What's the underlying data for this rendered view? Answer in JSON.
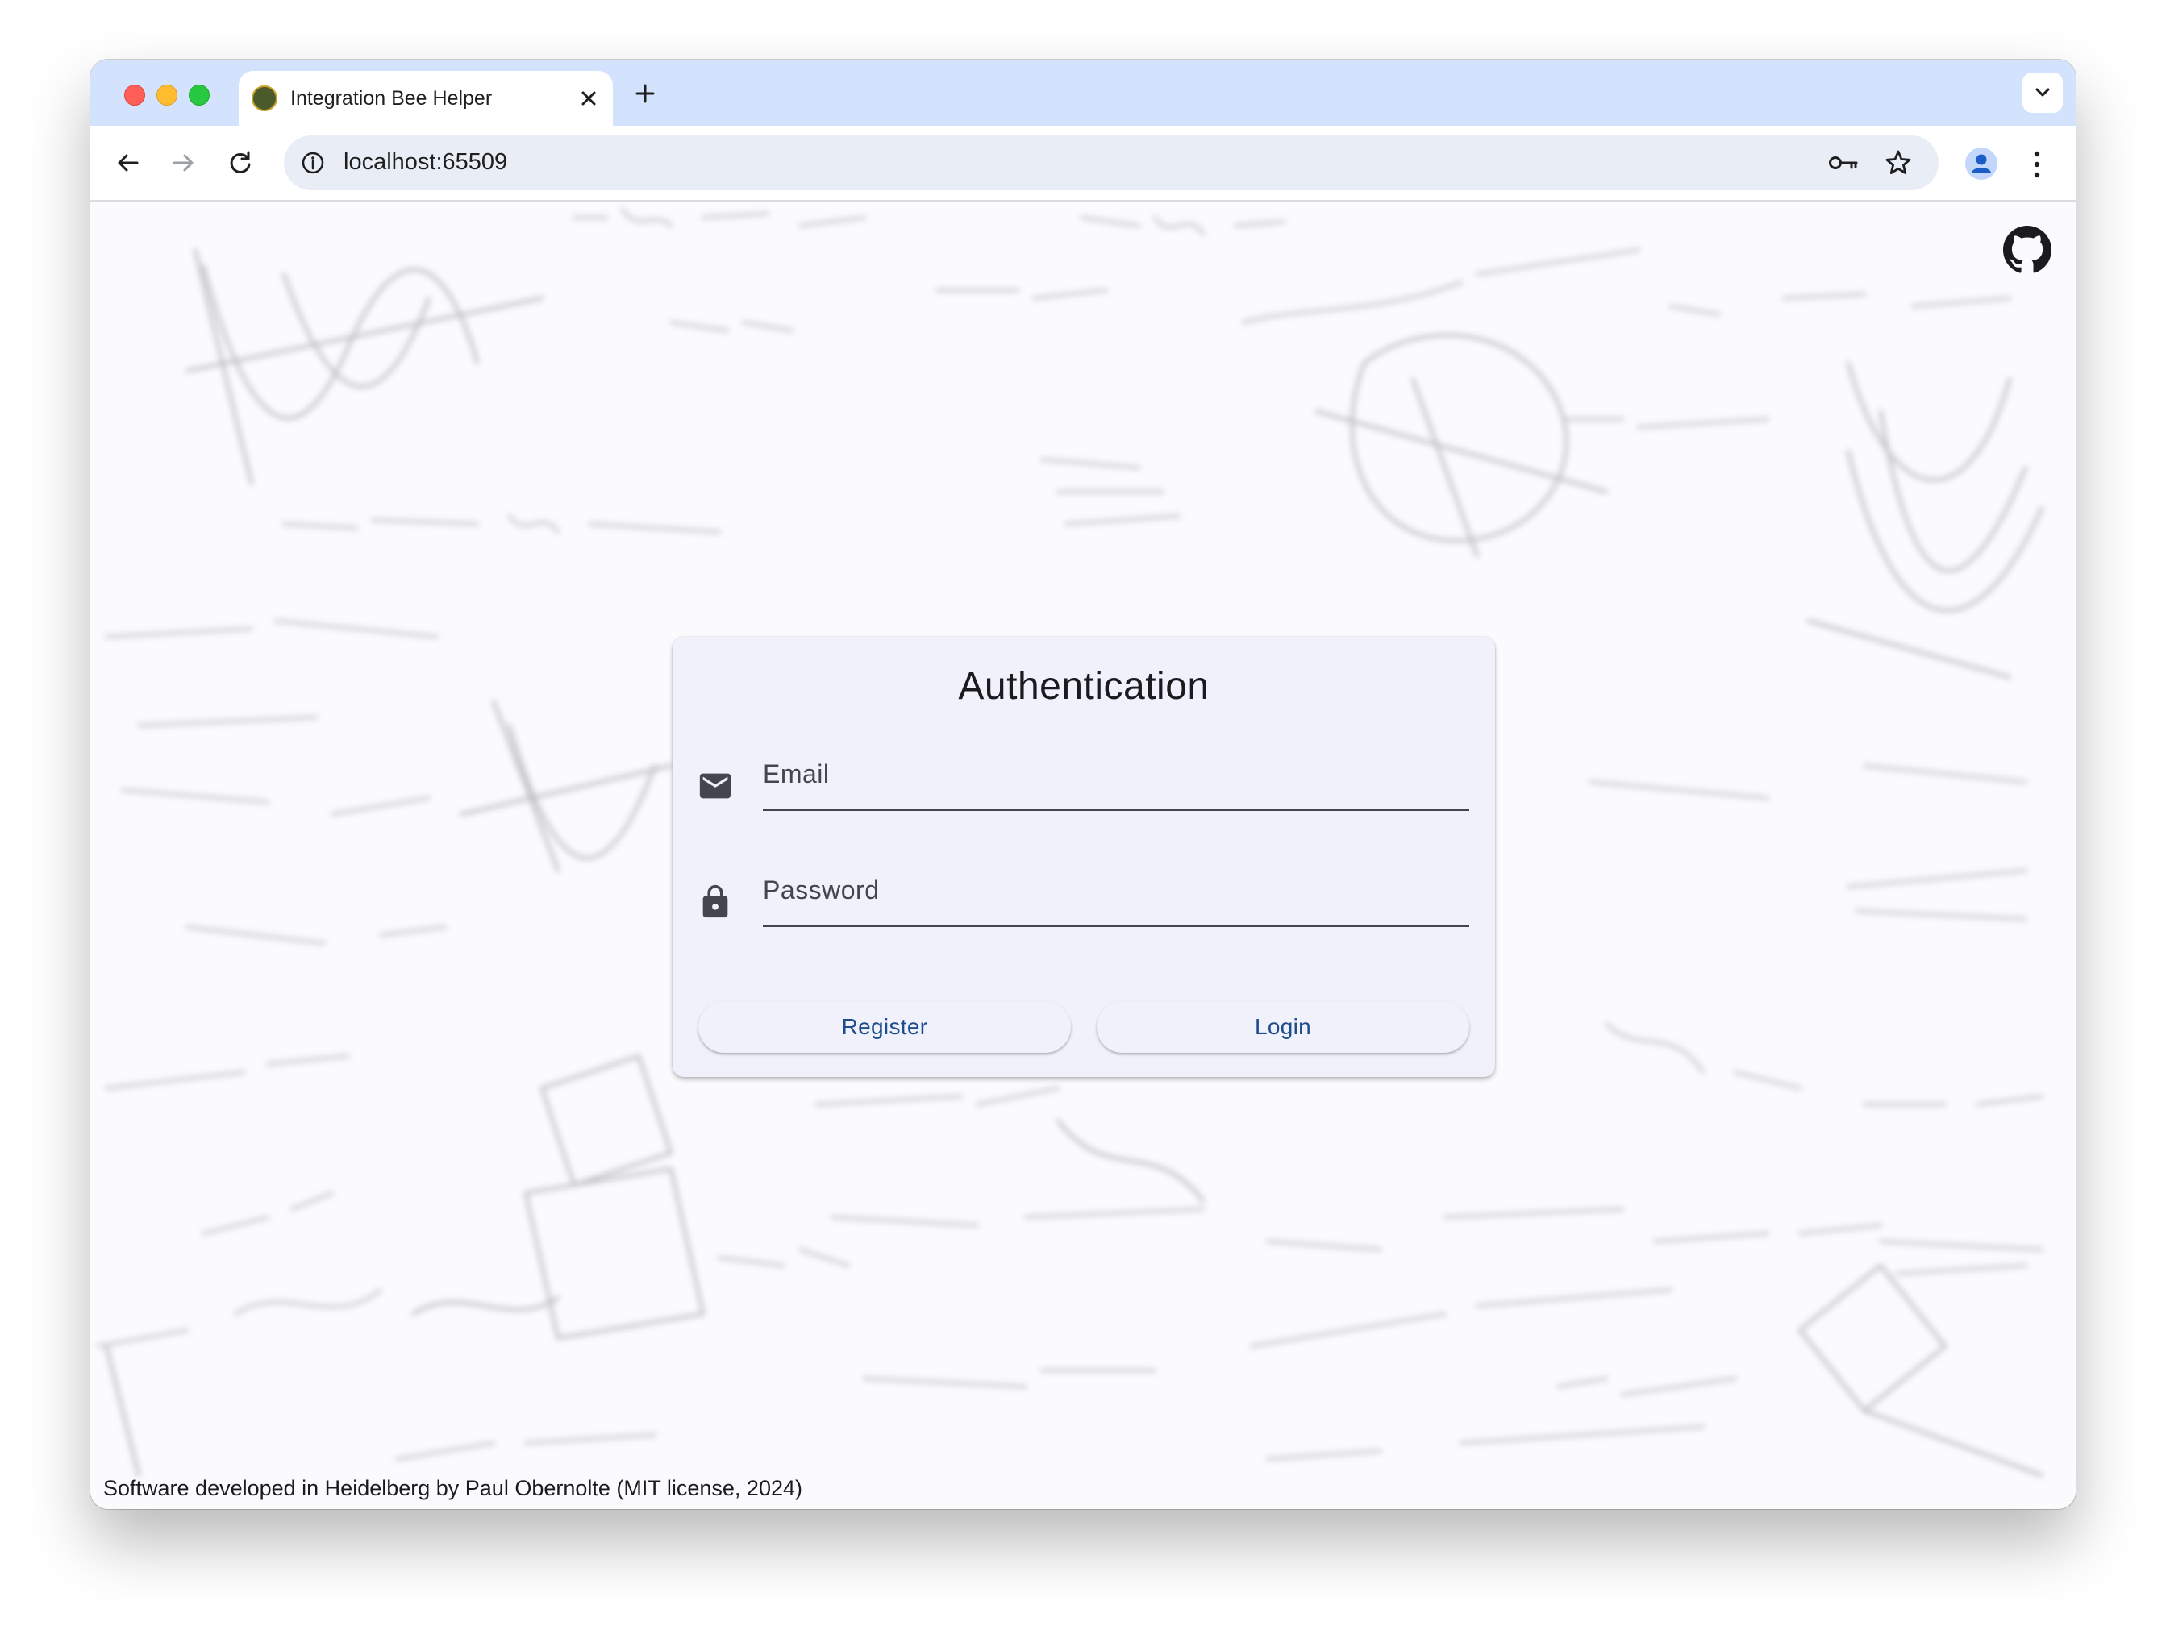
{
  "browser": {
    "tab_title": "Integration Bee Helper",
    "url": "localhost:65509"
  },
  "auth": {
    "title": "Authentication",
    "email_label": "Email",
    "password_label": "Password",
    "register_label": "Register",
    "login_label": "Login"
  },
  "footer": {
    "text": "Software developed in Heidelberg by Paul Obernolte (MIT license, 2024)"
  },
  "icons": {
    "email": "mail-icon",
    "password": "lock-icon",
    "github": "github-icon"
  },
  "colors": {
    "tabbar": "#d3e3fd",
    "omnibox": "#e9eef6",
    "card": "#f0f1fa",
    "button_text": "#1d4d8c"
  }
}
